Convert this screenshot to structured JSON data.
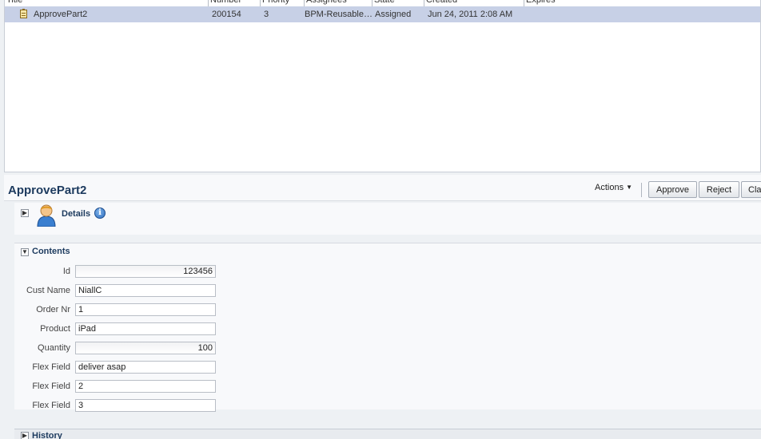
{
  "task_list": {
    "columns": [
      "Title",
      "Number",
      "Priority",
      "Assignees",
      "State",
      "Created",
      "Expires"
    ],
    "rows": [
      {
        "title": "ApprovePart2",
        "number": "200154",
        "priority": "3",
        "assignees": "BPM-Reusable…",
        "state": "Assigned",
        "created": "Jun 24, 2011 2:08 AM",
        "expires": ""
      }
    ]
  },
  "detail": {
    "title": "ApprovePart2",
    "actions_label": "Actions",
    "buttons": {
      "approve": "Approve",
      "reject": "Reject",
      "claim": "Claim"
    }
  },
  "details_section": {
    "label": "Details",
    "info_icon_glyph": "i"
  },
  "contents_section": {
    "label": "Contents",
    "fields": [
      {
        "label": "Id",
        "value": "123456"
      },
      {
        "label": "Cust Name",
        "value": "NiallC"
      },
      {
        "label": "Order Nr",
        "value": "1"
      },
      {
        "label": "Product",
        "value": "iPad"
      },
      {
        "label": "Quantity",
        "value": "100"
      },
      {
        "label": "Flex Field",
        "value": "deliver asap"
      },
      {
        "label": "Flex Field",
        "value": "2"
      },
      {
        "label": "Flex Field",
        "value": "3"
      }
    ]
  },
  "history_section": {
    "label": "History"
  },
  "icons": {
    "task": "task-icon",
    "person": "person-icon",
    "info": "info-icon",
    "expand": "disclosure-collapsed-icon",
    "collapse": "disclosure-expanded-icon"
  },
  "colors": {
    "selected_row": "#c7d0e6",
    "title_text": "#1c3a5e",
    "page_background": "#eef1f4"
  }
}
